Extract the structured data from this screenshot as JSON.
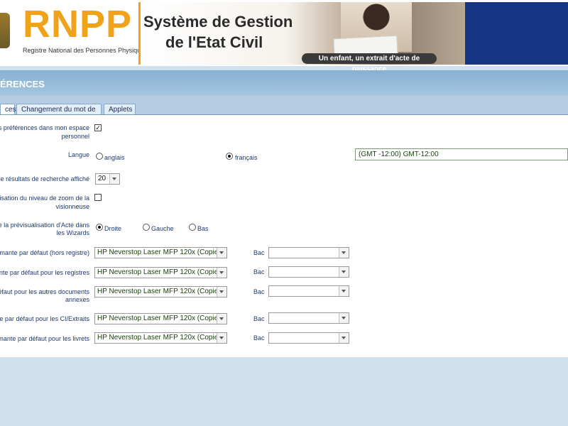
{
  "banner": {
    "logo_text": "RNPP",
    "logo_subtitle": "Registre National des Personnes Physiques",
    "title_line1": "Système de Gestion",
    "title_line2": "de l'Etat Civil",
    "slogan": "Un enfant, un extrait d'acte de naissance"
  },
  "section": {
    "title": "ÉRENCES"
  },
  "tabs": [
    {
      "label": "ces",
      "active": true
    },
    {
      "label": "Changement du mot de passe",
      "active": false
    },
    {
      "label": "Applets",
      "active": false
    }
  ],
  "form": {
    "personal_prefs": {
      "label_line1": "r les préférences dans mon espace",
      "label_line2": "personnel",
      "checked": true,
      "mark": "✓"
    },
    "language": {
      "label": "Langue",
      "options": [
        {
          "label": "anglais",
          "selected": false
        },
        {
          "label": "français",
          "selected": true
        }
      ],
      "timezone_value": "(GMT -12:00) GMT-12:00"
    },
    "results_count": {
      "label": "re de résultats de recherche affiché",
      "value": "20"
    },
    "zoom_memory": {
      "label_line1": "émorisation du niveau de zoom de la",
      "label_line2": "visionneuse",
      "checked": false
    },
    "preview_position": {
      "label_line1": "nt de la prévisualisation d'Acte dans",
      "label_line2": "les Wizards",
      "options": [
        {
          "label": "Droite",
          "selected": true
        },
        {
          "label": "Gauche",
          "selected": false
        },
        {
          "label": "Bas",
          "selected": false
        }
      ]
    },
    "printers": [
      {
        "label_line1": "mprimante par défaut (hors registre)",
        "label_line2": "",
        "value": "HP Neverstop Laser MFP 120x (Copie 1)",
        "bac_label": "Bac",
        "bac_value": ""
      },
      {
        "label_line1": "imante par défaut pour les registres",
        "label_line2": "",
        "value": "HP Neverstop Laser MFP 120x (Copie 1)",
        "bac_label": "Bac",
        "bac_value": ""
      },
      {
        "label_line1": "ar défaut pour les autres documents",
        "label_line2": "annexes",
        "value": "HP Neverstop Laser MFP 120x (Copie 1)",
        "bac_label": "Bac",
        "bac_value": ""
      },
      {
        "label_line1": "mante par défaut pour les CI/Extraits",
        "label_line2": "",
        "value": "HP Neverstop Laser MFP 120x (Copie 1)",
        "bac_label": "Bac",
        "bac_value": ""
      },
      {
        "label_line1": "mprimante par défaut pour les livrets",
        "label_line2": "",
        "value": "HP Neverstop Laser MFP 120x (Copie 1)",
        "bac_label": "Bac",
        "bac_value": ""
      }
    ]
  },
  "colors": {
    "accent": "#f0a21a",
    "navy": "#173585",
    "header_blue": "#86b0d2",
    "label_blue": "#1f3a6b"
  }
}
